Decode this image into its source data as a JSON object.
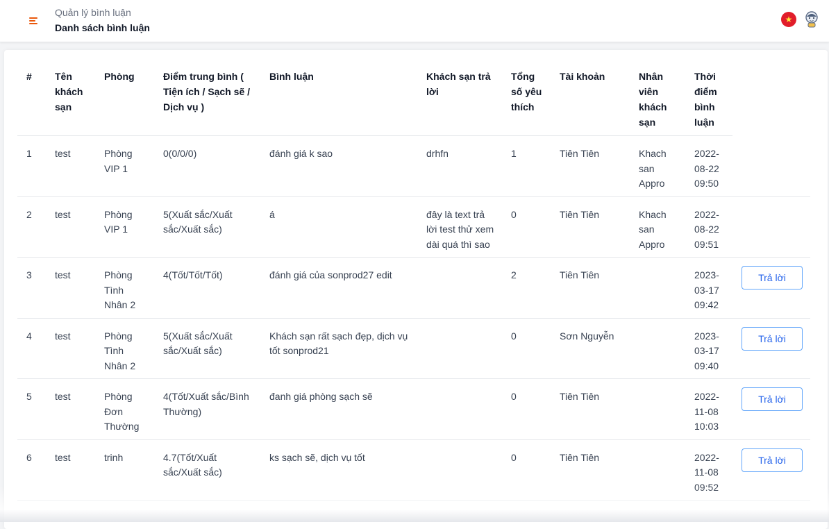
{
  "header": {
    "breadcrumb": "Quản lý bình luận",
    "title": "Danh sách bình luận",
    "menu_icon": "menu-icon",
    "language_flag": "★",
    "accent_color": "#ea580c"
  },
  "table": {
    "columns": [
      "#",
      "Tên khách sạn",
      "Phòng",
      "Điểm trung bình ( Tiện ích / Sạch sẽ / Dịch vụ )",
      "Bình luận",
      "Khách sạn trả lời",
      "Tổng số yêu thích",
      "Tài khoản",
      "Nhân viên khách sạn",
      "Thời điểm bình luận"
    ],
    "reply_label": "Trả lời",
    "rows": [
      {
        "no": "1",
        "hotel": "test",
        "room": "Phòng VIP 1",
        "score": "0(0/0/0)",
        "comment": "đánh giá k sao",
        "reply": "drhfn",
        "likes": "1",
        "account": "Tiên Tiên",
        "staff": "Khach san Appro",
        "time": "2022-08-22 09:50",
        "has_reply_button": false
      },
      {
        "no": "2",
        "hotel": "test",
        "room": "Phòng VIP 1",
        "score": "5(Xuất sắc/Xuất sắc/Xuất sắc)",
        "comment": "á",
        "reply": "đây là text trả lời test thử xem dài quá thì sao",
        "likes": "0",
        "account": "Tiên Tiên",
        "staff": "Khach san Appro",
        "time": "2022-08-22 09:51",
        "has_reply_button": false
      },
      {
        "no": "3",
        "hotel": "test",
        "room": "Phòng Tình Nhân 2",
        "score": "4(Tốt/Tốt/Tốt)",
        "comment": "đánh giá của sonprod27 edit",
        "reply": "",
        "likes": "2",
        "account": "Tiên Tiên",
        "staff": "",
        "time": "2023-03-17 09:42",
        "has_reply_button": true
      },
      {
        "no": "4",
        "hotel": "test",
        "room": "Phòng Tình Nhân 2",
        "score": "5(Xuất sắc/Xuất sắc/Xuất sắc)",
        "comment": "Khách sạn rất sạch đẹp, dịch vụ tốt sonprod21",
        "reply": "",
        "likes": "0",
        "account": "Sơn Nguyễn",
        "staff": "",
        "time": "2023-03-17 09:40",
        "has_reply_button": true
      },
      {
        "no": "5",
        "hotel": "test",
        "room": "Phòng Đơn Thường",
        "score": "4(Tốt/Xuất sắc/Bình Thường)",
        "comment": "đanh giá phòng sạch sẽ",
        "reply": "",
        "likes": "0",
        "account": "Tiên Tiên",
        "staff": "",
        "time": "2022-11-08 10:03",
        "has_reply_button": true
      },
      {
        "no": "6",
        "hotel": "test",
        "room": "trinh",
        "score": "4.7(Tốt/Xuất sắc/Xuất sắc)",
        "comment": "ks sạch sẽ, dịch vụ tốt",
        "reply": "",
        "likes": "0",
        "account": "Tiên Tiên",
        "staff": "",
        "time": "2022-11-08 09:52",
        "has_reply_button": true
      }
    ]
  }
}
